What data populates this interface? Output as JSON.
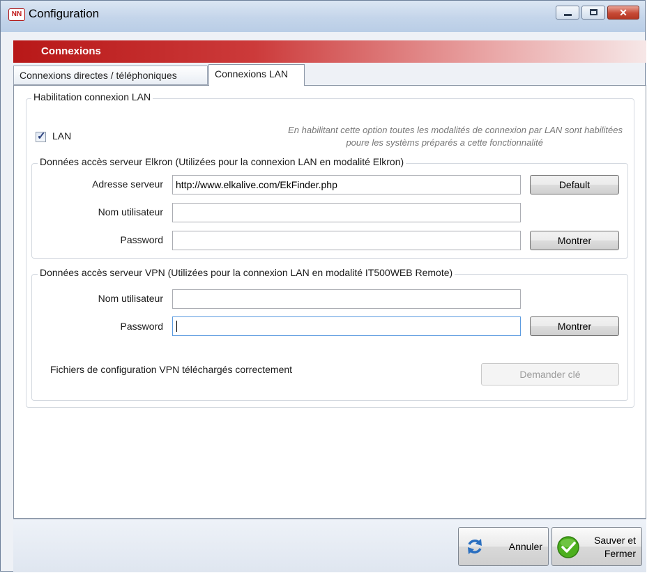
{
  "window": {
    "title": "Configuration",
    "app_icon_text": "NN"
  },
  "banner": {
    "title": "Connexions"
  },
  "tabs": [
    {
      "label": "Connexions directes / téléphoniques",
      "active": false
    },
    {
      "label": "Connexions LAN",
      "active": true
    }
  ],
  "lan_group": {
    "legend": "Habilitation connexion LAN",
    "lan_checkbox": {
      "label": "LAN",
      "checked": true
    },
    "hint_line1": "En habilitant cette option toutes les modalités de connexion par LAN sont habilitées",
    "hint_line2": "poure les systèms préparés a cette fonctionnalité"
  },
  "elkron_group": {
    "legend": "Données accès serveur Elkron (Utilizées pour la connexion LAN en modalité Elkron)",
    "server_label": "Adresse serveur",
    "server_value": "http://www.elkalive.com/EkFinder.php",
    "default_button": "Default",
    "user_label": "Nom utilisateur",
    "user_value": "",
    "password_label": "Password",
    "password_value": "",
    "show_button": "Montrer"
  },
  "vpn_group": {
    "legend": "Données accès serveur VPN (Utilizées pour la connexion LAN en modalité IT500WEB Remote)",
    "user_label": "Nom utilisateur",
    "user_value": "",
    "password_label": "Password",
    "password_value": "",
    "show_button": "Montrer",
    "status_text": "Fichiers de configuration VPN téléchargés correctement",
    "request_key_button": "Demander clé"
  },
  "footer": {
    "cancel_label": "Annuler",
    "save_line1": "Sauver et",
    "save_line2": "Fermer"
  },
  "colors": {
    "banner_red": "#b81818",
    "checkmark": "#283e7a",
    "save_icon_green": "#4caf1e",
    "cancel_icon_blue": "#2a6fc0"
  }
}
